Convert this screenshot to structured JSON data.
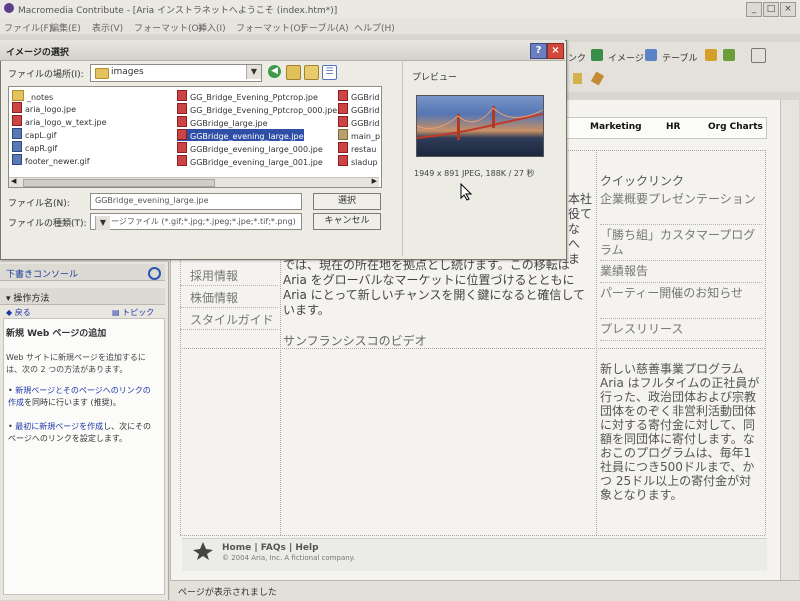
{
  "app": {
    "title": "Macromedia Contribute - [Aria インストラネットへようこそ (index.htm*)]",
    "menus": [
      "ファイル(F)",
      "編集(E)",
      "表示(V)",
      "フォーマット(O)",
      "挿入(I)",
      "フォーマット(O)",
      "テーブル(A)",
      "ヘルプ(H)"
    ],
    "window_buttons": [
      "_",
      "□",
      "×"
    ]
  },
  "toolbar_right": {
    "image_label": "イメージ",
    "table_label": "テーブル",
    "link_label_partial": "ンク"
  },
  "dialog": {
    "title": "イメージの選択",
    "help_label": "?",
    "close_label": "×",
    "look_in_label": "ファイルの場所(I):",
    "look_in_value": "images",
    "preview_label": "プレビュー",
    "preview_info": "1949 x 891 JPEG, 188K / 27 秒",
    "file_name_label": "ファイル名(N):",
    "file_name_value": "GGBridge_evening_large.jpe",
    "file_type_label": "ファイルの種類(T):",
    "file_type_value": "イメージファイル (*.gif;*.jpg;*.jpeg;*.jpe;*.tif;*.png)",
    "select_button": "選択",
    "cancel_button": "キャンセル",
    "files_col1": [
      {
        "name": "_notes",
        "kind": "folder"
      },
      {
        "name": "aria_logo.jpe",
        "kind": "image"
      },
      {
        "name": "aria_logo_w_text.jpe",
        "kind": "image"
      },
      {
        "name": "capL.gif",
        "kind": "gif"
      },
      {
        "name": "capR.gif",
        "kind": "gif"
      },
      {
        "name": "footer_newer.gif",
        "kind": "gif"
      }
    ],
    "files_col2": [
      {
        "name": "GG_Bridge_Evening_Pptcrop.jpe",
        "kind": "image"
      },
      {
        "name": "GG_Bridge_Evening_Pptcrop_000.jpe",
        "kind": "image"
      },
      {
        "name": "GGBridge_large.jpe",
        "kind": "image"
      },
      {
        "name": "GGBridge_evening_large.jpe",
        "kind": "image",
        "selected": true
      },
      {
        "name": "GGBridge_evening_large_000.jpe",
        "kind": "image"
      },
      {
        "name": "GGBridge_evening_large_001.jpe",
        "kind": "image"
      }
    ],
    "files_col3": [
      {
        "name": "GGBrid",
        "kind": "image"
      },
      {
        "name": "GGBrid",
        "kind": "image"
      },
      {
        "name": "GGBrid",
        "kind": "image"
      },
      {
        "name": "main_p",
        "kind": "jpg"
      },
      {
        "name": "restau",
        "kind": "image"
      },
      {
        "name": "sladup",
        "kind": "image"
      }
    ]
  },
  "page_nav": [
    "e",
    "Marketing",
    "HR",
    "Org Charts"
  ],
  "left_links": [
    "採用情報",
    "株価情報",
    "スタイルガイド"
  ],
  "main": {
    "text": "では、現在の所在地を拠点とし続けます。この移転は Aria をグローバルなマーケットに位置づけるとともに Aria にとって新しいチャンスを開く鍵になると確信しています。",
    "video_title": "サンフランシスコのビデオ",
    "frag1": "本社",
    "frag2": "役て",
    "frag3": "な",
    "frag4": "へ",
    "frag5": "ま"
  },
  "quick_links": {
    "heading": "クイックリンク",
    "items": [
      "企業概要プレゼンテーション",
      "「勝ち組」カスタマープログラム",
      "業績報告",
      "パーティー開催のお知らせ",
      "プレスリリース"
    ]
  },
  "news": "新しい慈善事業プログラム Aria はフルタイムの正社員が行った、政治団体および宗教団体をのぞく非営利活動団体に対する寄付金に対して、同額を同団体に寄付します。なおこのプログラムは、毎年1社員につき500ドルまで、かつ 25ドル以上の寄付金が対象となります。",
  "footer": {
    "links": "Home | FAQs | Help",
    "copyright": "© 2004 Aria, Inc. A fictional company."
  },
  "left_panels": {
    "drafts_console": "下書きコンソール",
    "how_to": "▾ 操作方法",
    "back": "戻る",
    "topics": "トピック",
    "help_title": "新規 Web ページの追加",
    "help_intro": "Web サイトに新規ページを追加するには、次の 2 つの方法があります。",
    "bullet1_link": "新規ページとそのページへのリンクの作成",
    "bullet1_rest": "を同時に行います (推奨)。",
    "bullet2_link": "最初に新規ページを作成",
    "bullet2_rest": "し、次にそのページへのリンクを設定します。"
  },
  "status": "ページが表示されました"
}
